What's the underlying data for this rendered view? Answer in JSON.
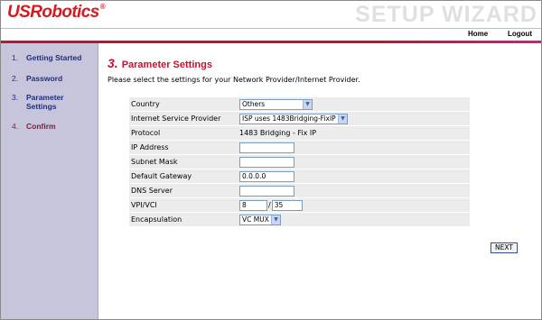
{
  "header": {
    "logo_text": "USRobotics",
    "logo_mark": "®",
    "wizard_title": "SETUP WIZARD",
    "brand_color": "#d71920"
  },
  "nav": {
    "home": "Home",
    "logout": "Logout"
  },
  "sidebar": {
    "steps": [
      {
        "num": "1.",
        "label": "Getting Started",
        "color": "#1f2f7a"
      },
      {
        "num": "2.",
        "label": "Password",
        "color": "#1f2f7a"
      },
      {
        "num": "3.",
        "label": "Parameter Settings",
        "color": "#1f2f7a"
      },
      {
        "num": "4.",
        "label": "Confirm",
        "color": "#7a2040"
      }
    ]
  },
  "main": {
    "title_num": "3.",
    "title": "Parameter Settings",
    "instructions": "Please select the settings for your Network Provider/Internet Provider.",
    "next_label": "NEXT"
  },
  "form": {
    "country_label": "Country",
    "country_value": "Others",
    "isp_label": "Internet Service Provider",
    "isp_value": "ISP uses 1483Bridging-FixIP",
    "protocol_label": "Protocol",
    "protocol_value": "1483 Bridging - Fix IP",
    "ip_label": "IP Address",
    "ip_value": "",
    "subnet_label": "Subnet Mask",
    "subnet_value": "",
    "gateway_label": "Default Gateway",
    "gateway_value": "0.0.0.0",
    "dns_label": "DNS Server",
    "dns_value": "",
    "vpivci_label": "VPI/VCI",
    "vpi_value": "8",
    "vci_separator": "/",
    "vci_value": "35",
    "encap_label": "Encapsulation",
    "encap_value": "VC MUX"
  }
}
